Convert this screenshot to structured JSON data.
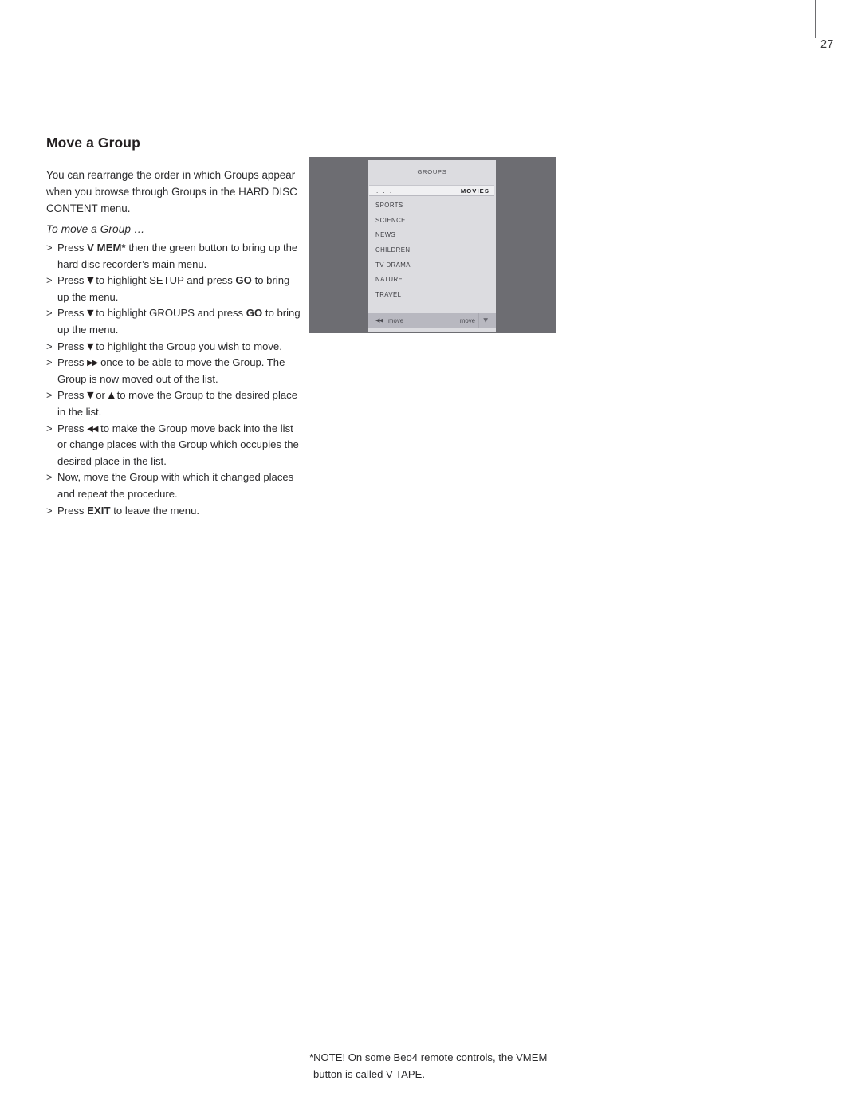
{
  "page": {
    "number": "27"
  },
  "article": {
    "headline": "Move a Group",
    "intro": "You can rearrange the order in which Groups appear when you browse through Groups in the HARD DISC CONTENT menu.",
    "subheading": "To move a Group …"
  },
  "steps": [
    {
      "id": "step-vmem",
      "segments": [
        {
          "type": "text",
          "value": "Press "
        },
        {
          "type": "bold",
          "value": "V MEM*"
        },
        {
          "type": "text",
          "value": " then the green button to bring up the hard disc recorder’s main menu."
        }
      ]
    },
    {
      "id": "step-setup",
      "segments": [
        {
          "type": "text",
          "value": "Press "
        },
        {
          "type": "glyph",
          "value": "▼",
          "name": "arrow-down-icon"
        },
        {
          "type": "text",
          "value": " to highlight SETUP and press "
        },
        {
          "type": "bold",
          "value": "GO"
        },
        {
          "type": "text",
          "value": " to bring up the menu."
        }
      ]
    },
    {
      "id": "step-groups",
      "segments": [
        {
          "type": "text",
          "value": "Press "
        },
        {
          "type": "glyph",
          "value": "▼",
          "name": "arrow-down-icon"
        },
        {
          "type": "text",
          "value": " to highlight GROUPS and press "
        },
        {
          "type": "bold",
          "value": "GO"
        },
        {
          "type": "text",
          "value": " to bring up the menu."
        }
      ]
    },
    {
      "id": "step-highlight-group",
      "segments": [
        {
          "type": "text",
          "value": "Press "
        },
        {
          "type": "glyph",
          "value": "▼",
          "name": "arrow-down-icon"
        },
        {
          "type": "text",
          "value": " to highlight the Group you wish to move."
        }
      ]
    },
    {
      "id": "step-move-out",
      "segments": [
        {
          "type": "text",
          "value": "Press "
        },
        {
          "type": "glyph",
          "value": "▶▶",
          "name": "fast-forward-icon"
        },
        {
          "type": "text",
          "value": " once to be able to move the Group. The Group is now moved out of the list."
        }
      ]
    },
    {
      "id": "step-reposition",
      "segments": [
        {
          "type": "text",
          "value": "Press "
        },
        {
          "type": "glyph",
          "value": "▼",
          "name": "arrow-down-icon"
        },
        {
          "type": "text",
          "value": " or "
        },
        {
          "type": "glyph",
          "value": "▲",
          "name": "arrow-up-icon"
        },
        {
          "type": "text",
          "value": " to move the Group to the desired place in the list."
        }
      ]
    },
    {
      "id": "step-move-back",
      "segments": [
        {
          "type": "text",
          "value": "Press "
        },
        {
          "type": "glyph",
          "value": "◀◀",
          "name": "rewind-icon"
        },
        {
          "type": "text",
          "value": " to make the Group move back into the list or change places with the Group which occupies the desired place in the list."
        }
      ]
    },
    {
      "id": "step-repeat",
      "segments": [
        {
          "type": "text",
          "value": "Now, move the Group with which it changed places and repeat the procedure."
        }
      ]
    },
    {
      "id": "step-exit",
      "segments": [
        {
          "type": "text",
          "value": "Press "
        },
        {
          "type": "bold",
          "value": "EXIT"
        },
        {
          "type": "text",
          "value": " to leave the menu."
        }
      ]
    }
  ],
  "tv_screen": {
    "menu_title": "GROUPS",
    "highlight_row": {
      "placeholder": ". . .",
      "label": "MOVIES"
    },
    "items": [
      "SPORTS",
      "SCIENCE",
      "NEWS",
      "CHILDREN",
      "TV  DRAMA",
      "NATURE",
      "TRAVEL"
    ],
    "footer": {
      "rewind_glyph": "◀◀",
      "move_left_label": "move",
      "move_right_label": "move",
      "down_glyph": "▼"
    },
    "colors": {
      "screen_background": "#6d6d72",
      "menu_background": "#dcdce0",
      "highlight_background": "#f0f0f2",
      "footer_background": "#b8b8c0"
    }
  },
  "footnote": {
    "line1": "*NOTE! On some Beo4 remote controls, the VMEM",
    "line2": "button is called V TAPE."
  }
}
